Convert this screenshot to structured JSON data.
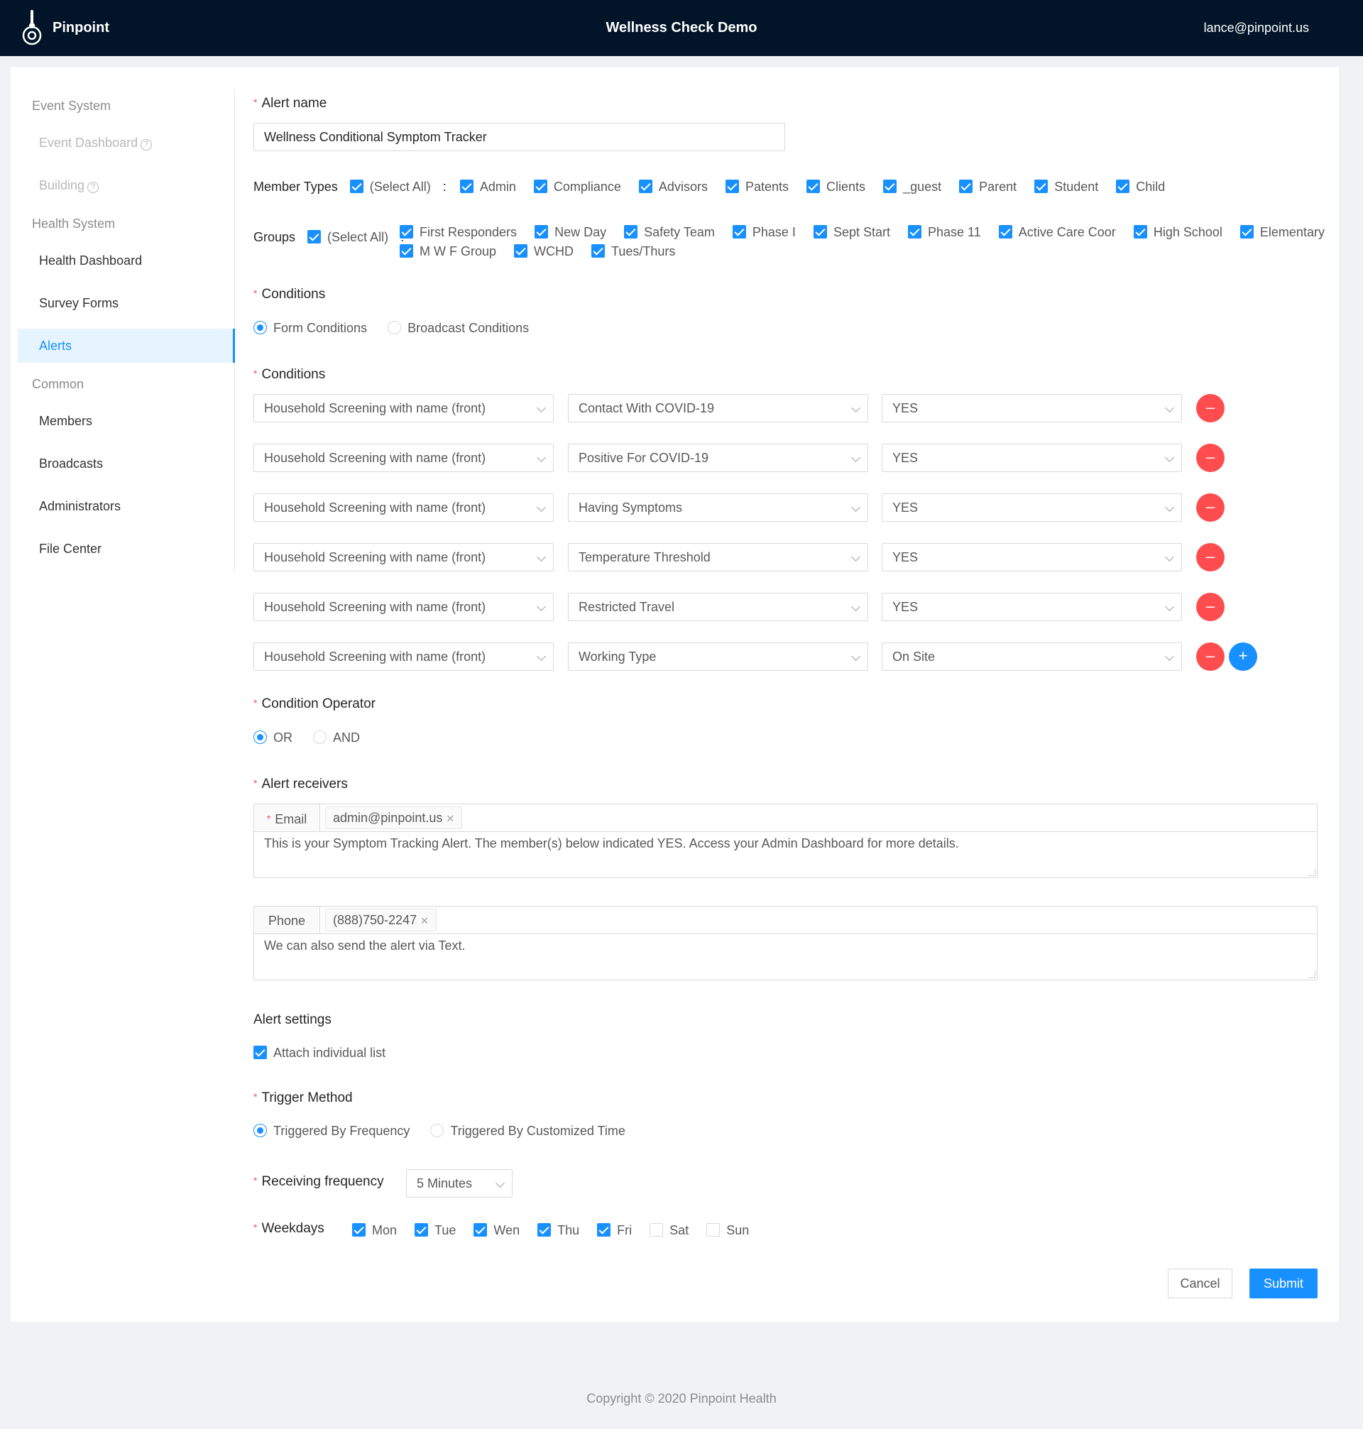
{
  "header": {
    "brand": "Pinpoint",
    "title": "Wellness Check Demo",
    "user": "lance@pinpoint.us"
  },
  "sidebar": {
    "groups": [
      "Event System",
      "Health System",
      "Common"
    ],
    "items": [
      "Event Dashboard",
      "Building",
      "Health Dashboard",
      "Survey Forms",
      "Alerts",
      "Members",
      "Broadcasts",
      "Administrators",
      "File Center"
    ],
    "active": "Alerts"
  },
  "form": {
    "alert_name_label": "Alert name",
    "alert_name_value": "Wellness Conditional Symptom Tracker",
    "member_types_label": "Member Types",
    "member_types": [
      "(Select All)",
      "Admin",
      "Compliance",
      "Advisors",
      "Patents",
      "Clients",
      "_guest",
      "Parent",
      "Student",
      "Child"
    ],
    "groups_label": "Groups",
    "groups_row1": [
      "(Select All)",
      "First Responders",
      "New Day",
      "Safety Team",
      "Phase I",
      "Sept Start",
      "Phase 11",
      "Active Care Coor",
      "High School",
      "Elementary"
    ],
    "groups_row2": [
      "M W F Group",
      "WCHD",
      "Tues/Thurs"
    ],
    "conditions_type_label": "Conditions",
    "conditions_type_options": [
      "Form Conditions",
      "Broadcast Conditions"
    ],
    "conditions_type_selected": "Form Conditions",
    "conditions_label": "Conditions",
    "conditions": [
      {
        "form": "Household Screening with name (front)",
        "question": "Contact With COVID-19",
        "answer": "YES"
      },
      {
        "form": "Household Screening with name (front)",
        "question": "Positive For COVID-19",
        "answer": "YES"
      },
      {
        "form": "Household Screening with name (front)",
        "question": "Having Symptoms",
        "answer": "YES"
      },
      {
        "form": "Household Screening with name (front)",
        "question": "Temperature Threshold",
        "answer": "YES"
      },
      {
        "form": "Household Screening with name (front)",
        "question": "Restricted Travel",
        "answer": "YES"
      },
      {
        "form": "Household Screening with name (front)",
        "question": "Working Type",
        "answer": "On Site"
      }
    ],
    "operator_label": "Condition Operator",
    "operator_options": [
      "OR",
      "AND"
    ],
    "operator_selected": "OR",
    "receivers_label": "Alert receivers",
    "email_label": "Email",
    "email_tag": "admin@pinpoint.us",
    "email_message": "This is your Symptom Tracking Alert. The member(s) below indicated YES. Access your Admin Dashboard for more details.",
    "phone_label": "Phone",
    "phone_tag": "(888)750-2247",
    "phone_message": "We can also send the alert via Text.",
    "settings_label": "Alert settings",
    "attach_label": "Attach individual list",
    "trigger_label": "Trigger Method",
    "trigger_options": [
      "Triggered By Frequency",
      "Triggered By Customized Time"
    ],
    "trigger_selected": "Triggered By Frequency",
    "frequency_label": "Receiving frequency",
    "frequency_value": "5 Minutes",
    "weekdays_label": "Weekdays",
    "weekdays": [
      {
        "label": "Mon",
        "checked": true
      },
      {
        "label": "Tue",
        "checked": true
      },
      {
        "label": "Wen",
        "checked": true
      },
      {
        "label": "Thu",
        "checked": true
      },
      {
        "label": "Fri",
        "checked": true
      },
      {
        "label": "Sat",
        "checked": false
      },
      {
        "label": "Sun",
        "checked": false
      }
    ],
    "cancel_label": "Cancel",
    "submit_label": "Submit"
  },
  "footer": {
    "copyright": "Copyright © 2020 Pinpoint Health"
  },
  "colors": {
    "header_bg": "#011428",
    "primary": "#1890ff",
    "danger": "#ff4d4f",
    "page_bg": "#f0f2f5"
  }
}
